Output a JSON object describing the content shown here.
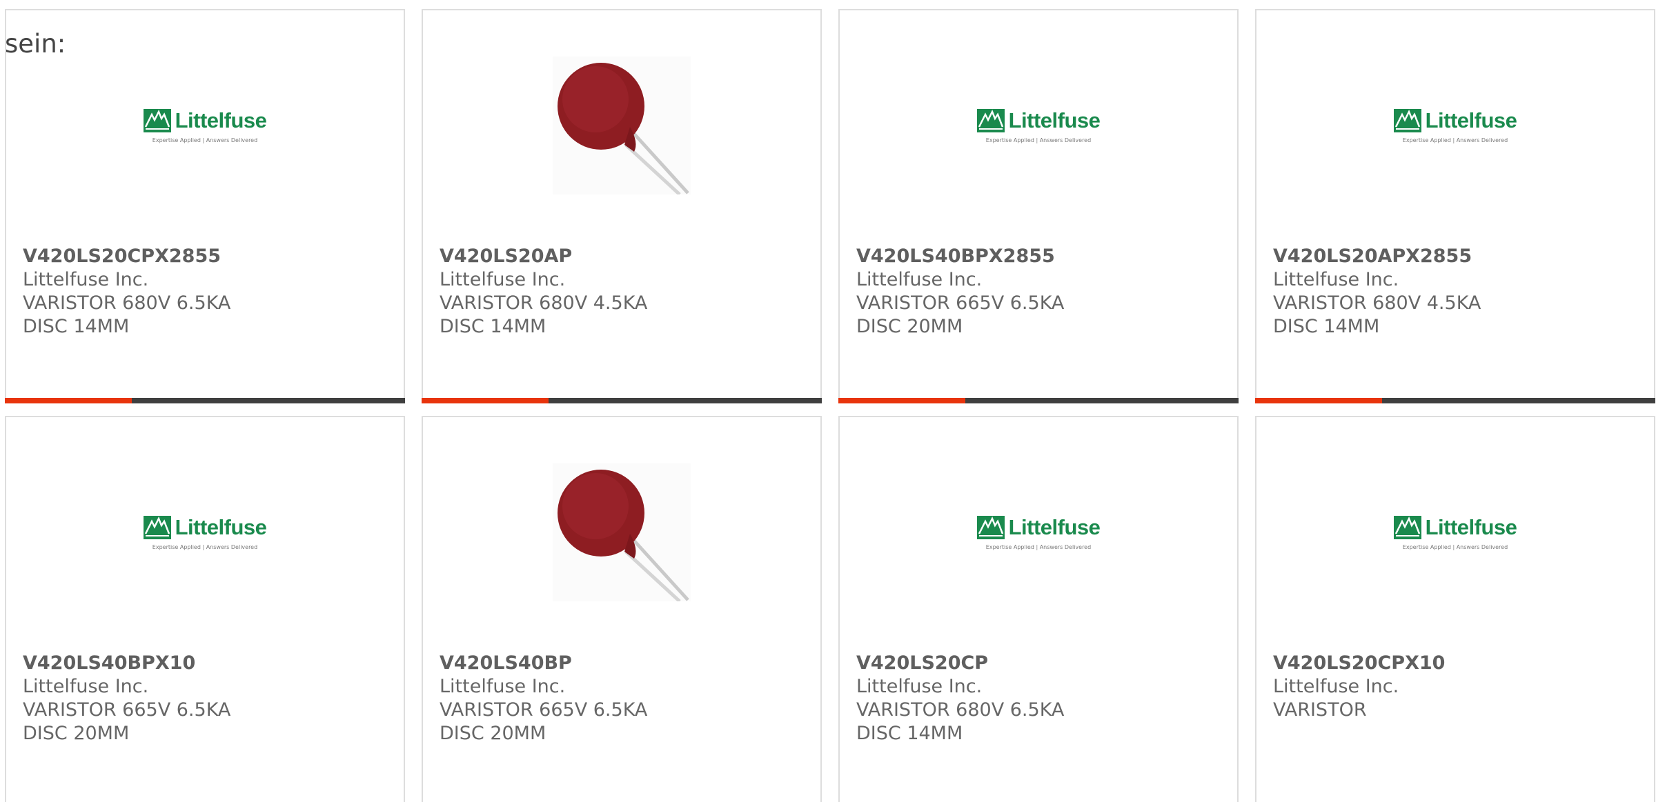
{
  "prefix_text": "sein:",
  "logo": {
    "word": "Littelfuse",
    "tagline": "Expertise Applied | Answers Delivered",
    "brand_color": "#1a8a4d"
  },
  "colors": {
    "accent": "#e8340c",
    "bar": "#3f3f3f",
    "varistor": "#8e1d22"
  },
  "products": [
    {
      "part": "V420LS20CPX2855",
      "maker": "Littelfuse Inc.",
      "desc": "VARISTOR 680V 6.5KA DISC 14MM",
      "image": "littelfuse-logo"
    },
    {
      "part": "V420LS20AP",
      "maker": "Littelfuse Inc.",
      "desc": "VARISTOR 680V 4.5KA DISC 14MM",
      "image": "varistor-disc"
    },
    {
      "part": "V420LS40BPX2855",
      "maker": "Littelfuse Inc.",
      "desc": "VARISTOR 665V 6.5KA DISC 20MM",
      "image": "littelfuse-logo"
    },
    {
      "part": "V420LS20APX2855",
      "maker": "Littelfuse Inc.",
      "desc": "VARISTOR 680V 4.5KA DISC 14MM",
      "image": "littelfuse-logo"
    },
    {
      "part": "V420LS40BPX10",
      "maker": "Littelfuse Inc.",
      "desc": "VARISTOR 665V 6.5KA DISC 20MM",
      "image": "littelfuse-logo"
    },
    {
      "part": "V420LS40BP",
      "maker": "Littelfuse Inc.",
      "desc": "VARISTOR 665V 6.5KA DISC 20MM",
      "image": "varistor-disc"
    },
    {
      "part": "V420LS20CP",
      "maker": "Littelfuse Inc.",
      "desc": "VARISTOR 680V 6.5KA DISC 14MM",
      "image": "littelfuse-logo"
    },
    {
      "part": "V420LS20CPX10",
      "maker": "Littelfuse Inc.",
      "desc": "VARISTOR",
      "image": "littelfuse-logo"
    }
  ]
}
